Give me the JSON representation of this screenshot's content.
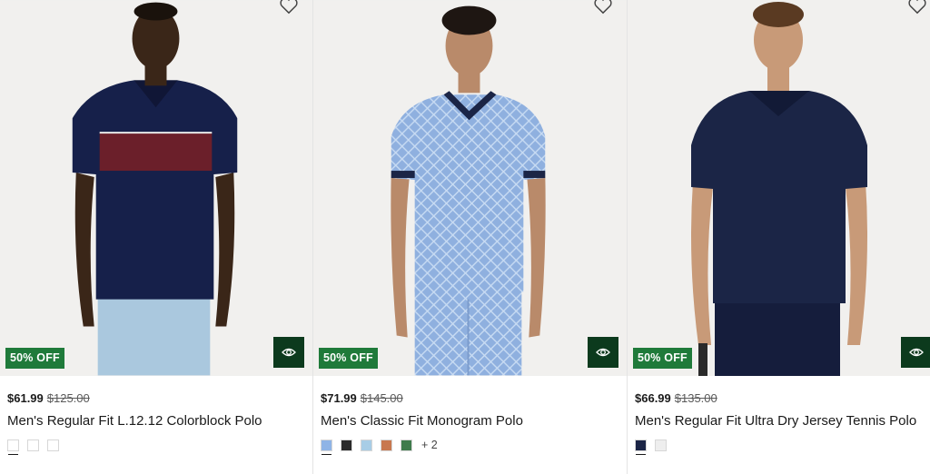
{
  "products": [
    {
      "badge": "50% OFF",
      "price_now": "$61.99",
      "price_was": "$125.00",
      "title": "Men's Regular Fit L.12.12 Colorblock Polo",
      "swatches": [
        "#ffffff",
        "#ffffff",
        "#ffffff"
      ],
      "more": ""
    },
    {
      "badge": "50% OFF",
      "price_now": "$71.99",
      "price_was": "$145.00",
      "title": "Men's Classic Fit Monogram Polo",
      "swatches": [
        "#8fb4e6",
        "#2b2b2b",
        "#a8cde6",
        "#c8784f",
        "#3f7b4c"
      ],
      "more": "+ 2"
    },
    {
      "badge": "50% OFF",
      "price_now": "$66.99",
      "price_was": "$135.00",
      "title": "Men's Regular Fit Ultra Dry Jersey Tennis Polo",
      "swatches": [
        "#1b2546",
        "#eeeeee"
      ],
      "more": ""
    }
  ],
  "colors": {
    "badge_bg": "#1f7a3a",
    "quickview_bg": "#0c3a1d"
  },
  "icons": {
    "wishlist": "heart-outline-icon",
    "quick_view": "eye-icon"
  }
}
